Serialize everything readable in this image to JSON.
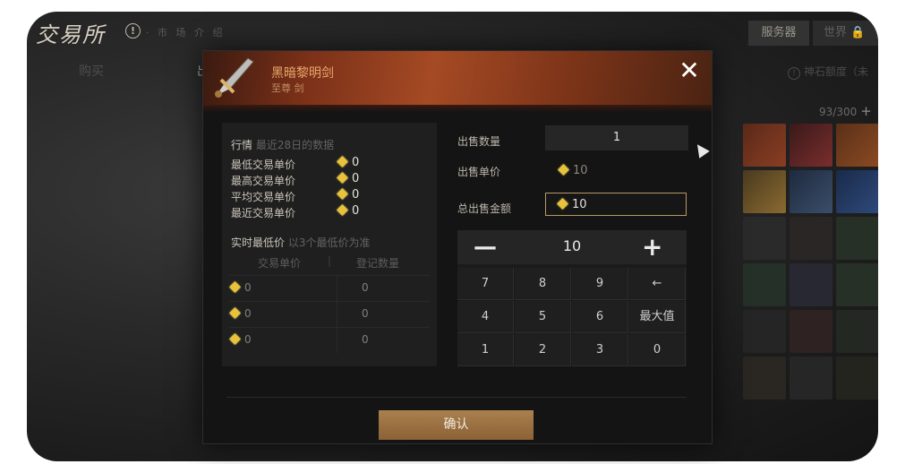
{
  "topbar": {
    "logo": "交易所",
    "faint_text": "· 市 场 介 绍",
    "server_tab": "服务器",
    "world_tab": "世界"
  },
  "tabs": {
    "buy": "购买",
    "sell": "出售"
  },
  "quota": "神石额度（未",
  "slots": "93/300",
  "item": {
    "name": "黑暗黎明剑",
    "sub": "至尊 剑"
  },
  "market": {
    "title": "行情",
    "subtitle": "最近28日的数据",
    "rows": [
      {
        "label": "最低交易单价",
        "value": "0"
      },
      {
        "label": "最高交易单价",
        "value": "0"
      },
      {
        "label": "平均交易单价",
        "value": "0"
      },
      {
        "label": "最近交易单价",
        "value": "0"
      }
    ]
  },
  "lowest": {
    "title": "实时最低价",
    "subtitle": "以3个最低价为准",
    "col1": "交易单价",
    "col2": "登记数量",
    "rows": [
      {
        "price": "0",
        "qty": "0"
      },
      {
        "price": "0",
        "qty": "0"
      },
      {
        "price": "0",
        "qty": "0"
      }
    ]
  },
  "form": {
    "qty_label": "出售数量",
    "qty_value": "1",
    "unit_label": "出售单价",
    "unit_value": "10",
    "total_label": "总出售金额",
    "total_value": "10"
  },
  "keypad": {
    "display": "10",
    "keys": [
      "7",
      "8",
      "9",
      "←",
      "4",
      "5",
      "6",
      "最大值",
      "1",
      "2",
      "3",
      "0"
    ]
  },
  "confirm_label": "确认",
  "colors": {
    "accent": "#a9804e",
    "gem": "#e8c23a",
    "header": "#a54a24"
  }
}
